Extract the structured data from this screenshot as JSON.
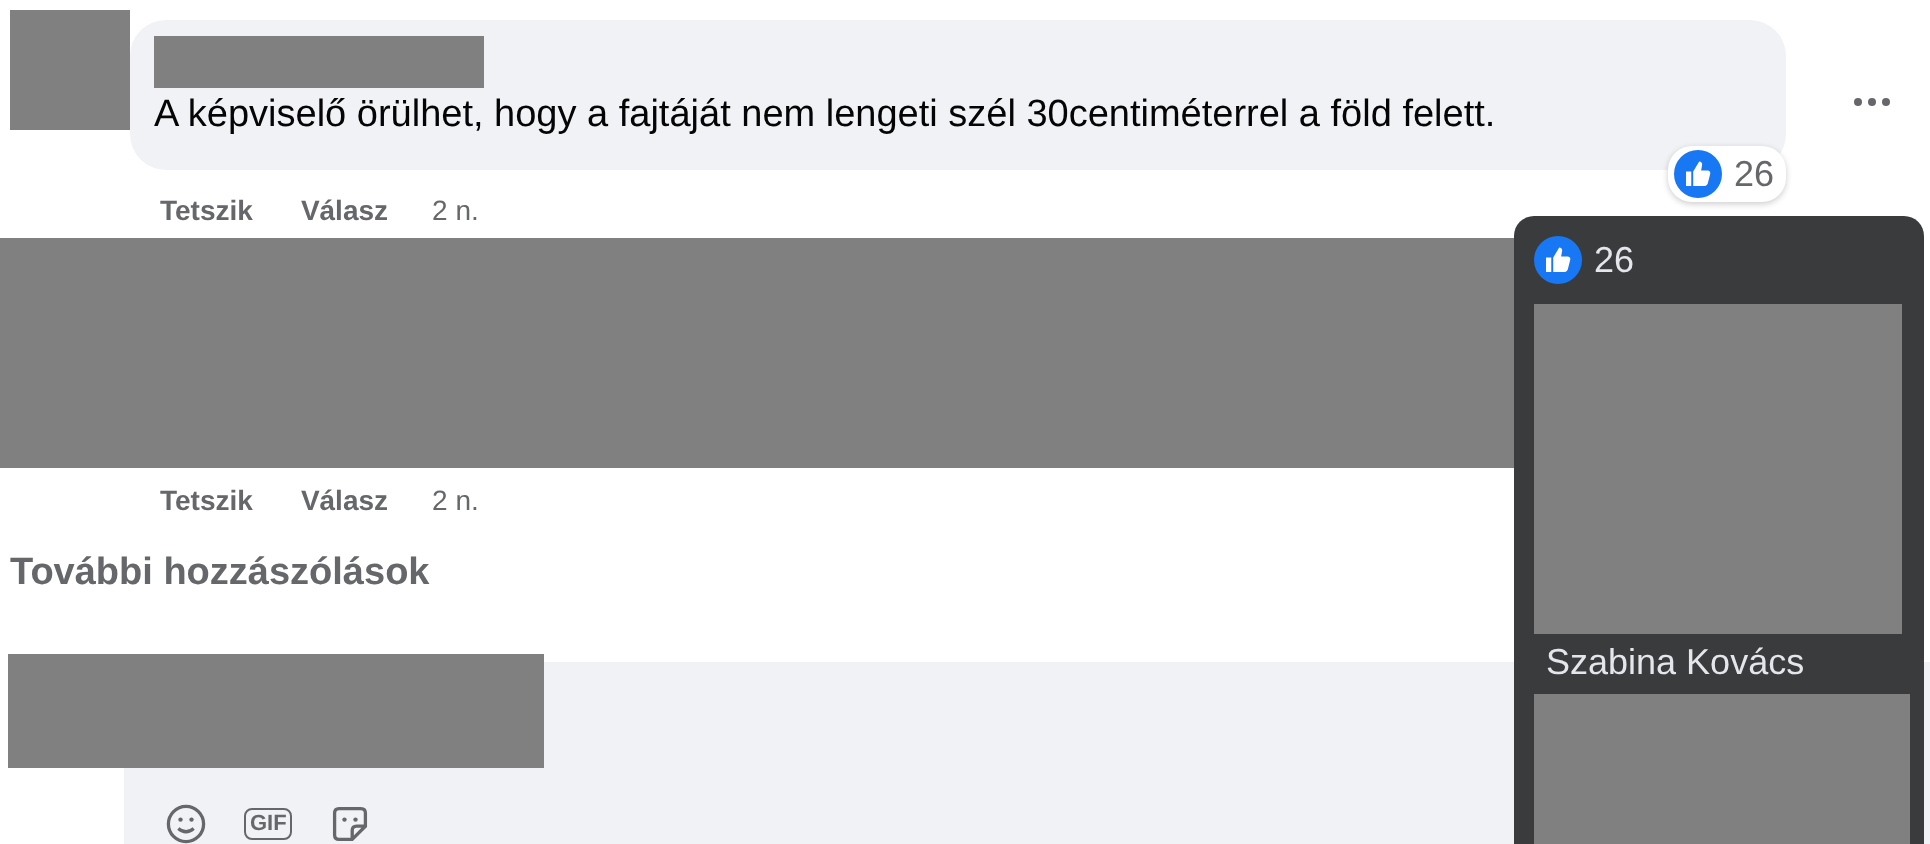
{
  "comments": [
    {
      "kind": "text",
      "text": "A képviselő örülhet, hogy a fajtáját nem lengeti szél 30centiméterrel a föld felett.",
      "reactions": "26",
      "actions": {
        "like": "Tetszik",
        "reply": "Válasz",
        "time": "2 n."
      }
    },
    {
      "kind": "hidden",
      "actions": {
        "like": "Tetszik",
        "reply": "Válasz",
        "time": "2 n."
      }
    }
  ],
  "more_comments": "További hozzászólások",
  "composer": {
    "gif_label": "GIF"
  },
  "reaction_popup": {
    "count": "26",
    "names": [
      "Szabina Kovács"
    ]
  }
}
